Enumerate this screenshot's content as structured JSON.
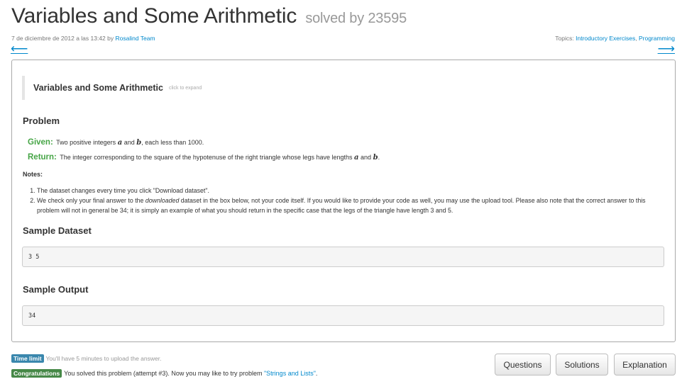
{
  "header": {
    "title": "Variables and Some Arithmetic",
    "solved": "solved by 23595",
    "date_by": "7 de diciembre de 2012 a las 13:42 by",
    "author": "Rosalind Team",
    "topics_label": "Topics:",
    "topics": [
      "Introductory Exercises",
      "Programming"
    ],
    "topics_separator": ", ",
    "prev_arrow": "⟵",
    "next_arrow": "⟶"
  },
  "problem": {
    "expand_title": "Variables and Some Arithmetic",
    "expand_hint": "click to expand",
    "heading": "Problem",
    "given_label": "Given:",
    "given_pre": "Two positive integers",
    "var_a": "a",
    "and_word": "and",
    "var_b": "b",
    "given_post": ", each less than 1000.",
    "return_label": "Return:",
    "return_pre": "The integer corresponding to the square of the hypotenuse of the right triangle whose legs have lengths",
    "return_post": ".",
    "notes_label": "Notes:",
    "note1": "The dataset changes every time you click \"Download dataset\".",
    "note2_pre": "We check only your final answer to the",
    "note2_em": "downloaded",
    "note2_post": "dataset in the box below, not your code itself. If you would like to provide your code as well, you may use the upload tool. Please also note that the correct answer to this problem will not in general be 34; it is simply an example of what you should return in the specific case that the legs of the triangle have length 3 and 5.",
    "sample_dataset_heading": "Sample Dataset",
    "sample_dataset": "3 5",
    "sample_output_heading": "Sample Output",
    "sample_output": "34"
  },
  "footer": {
    "time_badge": "Time limit",
    "time_text": "You'll have 5 minutes to upload the answer.",
    "congrats_badge": "Congratulations",
    "congrats_text": "You solved this problem (attempt #3). Now you may like to try problem",
    "next_problem": "\"Strings and Lists\"",
    "congrats_end": ".",
    "buttons": [
      "Questions",
      "Solutions",
      "Explanation"
    ]
  },
  "colors": {
    "link": "#0088cc",
    "given_return_label": "#46a546",
    "badge_info": "#3a87ad",
    "badge_success": "#468847"
  }
}
